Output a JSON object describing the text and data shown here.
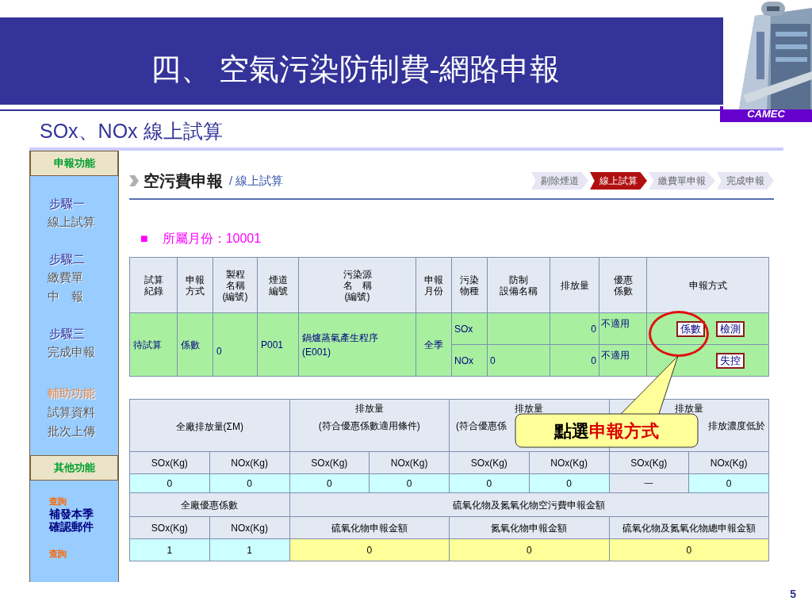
{
  "slide": {
    "title": "四、 空氣污染防制費-網路申報",
    "subtitle": "SOx、NOx 線上試算",
    "logo": "CAMEC",
    "page_number": "5"
  },
  "sidebar": {
    "items": [
      {
        "kind": "header",
        "label": "申報功能"
      },
      {
        "kind": "step",
        "label": "步驟一"
      },
      {
        "kind": "link",
        "label": "線上試算"
      },
      {
        "kind": "step",
        "label": "步驟二"
      },
      {
        "kind": "link",
        "label": "繳費單"
      },
      {
        "kind": "link",
        "label": "中　報"
      },
      {
        "kind": "step",
        "label": "步驟三"
      },
      {
        "kind": "link",
        "label": "完成申報"
      },
      {
        "kind": "aux",
        "label": "輔助功能"
      },
      {
        "kind": "link",
        "label": "試算資料"
      },
      {
        "kind": "link",
        "label": "批次上傳"
      },
      {
        "kind": "header",
        "label": "其他功能"
      },
      {
        "kind": "query",
        "label": "查詢"
      },
      {
        "kind": "bold",
        "label": "補發本季"
      },
      {
        "kind": "bold",
        "label": "確認郵件"
      },
      {
        "kind": "query",
        "label": "查詢"
      }
    ]
  },
  "page": {
    "heading": "空污費申報",
    "breadcrumb": "/ 線上試算",
    "steps": [
      {
        "label": "剔除煙道",
        "selected": false
      },
      {
        "label": "線上試算",
        "selected": true
      },
      {
        "label": "繳費單申報",
        "selected": false
      },
      {
        "label": "完成申報",
        "selected": false
      }
    ],
    "month": {
      "marker": "■",
      "label": "所屬月份：10001"
    }
  },
  "trial_table": {
    "columns": [
      [
        "試算",
        "紀錄"
      ],
      [
        "申報",
        "方式"
      ],
      [
        "製程",
        "名稱",
        "(編號)"
      ],
      [
        "煙道",
        "編號"
      ],
      [
        "污染源",
        "名　稱",
        "(編號)"
      ],
      [
        "申報",
        "月份"
      ],
      [
        "污染",
        "物種"
      ],
      [
        "防制",
        "設備名稱"
      ],
      [
        "排放量"
      ],
      [
        "優惠",
        "係數"
      ],
      [
        "申報方式"
      ]
    ],
    "row": {
      "record": "待試算",
      "method": "係數",
      "process": "0",
      "stack": "P001",
      "source": [
        "鍋爐蒸氣產生程序",
        "(E001)"
      ],
      "month": "全季",
      "pollutants": [
        {
          "species": "SOx",
          "emission": "0",
          "discount": "不適用",
          "buttons": [
            "係數",
            "檢測"
          ]
        },
        {
          "species": "NOx",
          "equipment": "0",
          "emission": "0",
          "discount": "不適用",
          "buttons": [
            "失控"
          ]
        }
      ]
    }
  },
  "callout": {
    "parts": [
      {
        "text": "點選",
        "color": "#000000"
      },
      {
        "text": "申報方式",
        "color": "#dd0000"
      }
    ]
  },
  "summary_table": {
    "groups": [
      {
        "lines": [
          "全廠排放量(ΣM)"
        ]
      },
      {
        "lines": [
          "排放量",
          "(符合優惠係數適用條件)"
        ]
      },
      {
        "lines": [
          "排放量",
          "(符合優惠係"
        ]
      },
      {
        "lines": [
          "排放量",
          "排放濃度低於"
        ]
      }
    ],
    "units": [
      "SOx(Kg)",
      "NOx(Kg)",
      "SOx(Kg)",
      "NOx(Kg)",
      "SOx(Kg)",
      "NOx(Kg)",
      "SOx(Kg)",
      "NOx(Kg)"
    ],
    "values": [
      {
        "text": "0",
        "kind": "value"
      },
      {
        "text": "0",
        "kind": "value"
      },
      {
        "text": "0",
        "kind": "value"
      },
      {
        "text": "0",
        "kind": "value"
      },
      {
        "text": "0",
        "kind": "value"
      },
      {
        "text": "0",
        "kind": "value"
      },
      {
        "text": "一",
        "kind": "na"
      },
      {
        "text": "0",
        "kind": "value"
      }
    ],
    "discount_title": "全廠優惠係數",
    "amount_title": "硫氧化物及氮氧化物空污費申報金額",
    "discount_units": [
      "SOx(Kg)",
      "NOx(Kg)"
    ],
    "amount_columns": [
      "硫氧化物申報金額",
      "氮氧化物申報金額",
      "硫氧化物及氮氧化物總申報金額"
    ],
    "discount_values": [
      "1",
      "1"
    ],
    "amount_values": [
      "0",
      "0",
      "0"
    ]
  }
}
